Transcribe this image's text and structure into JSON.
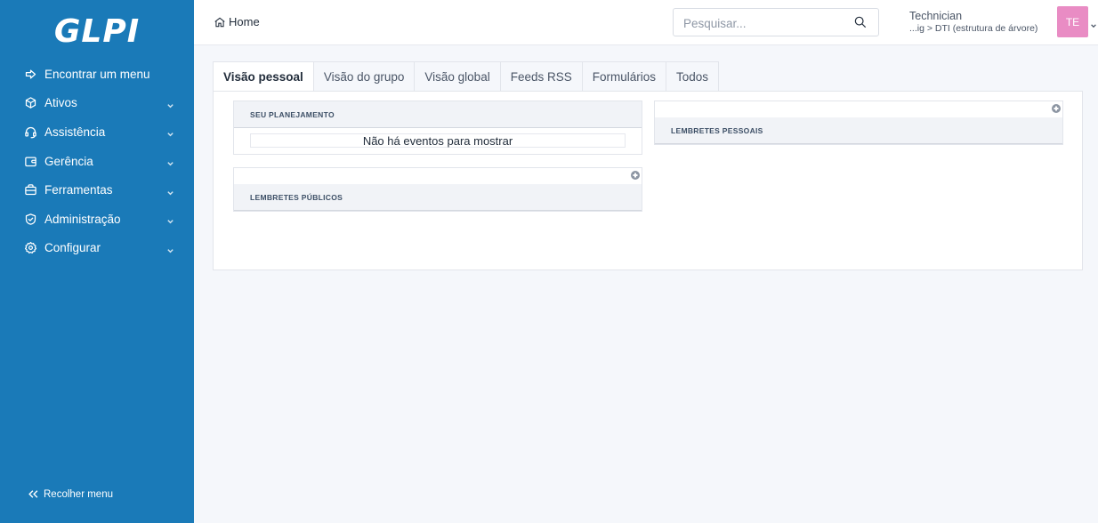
{
  "sidebar": {
    "logo": "GLPI",
    "items": [
      {
        "label": "Encontrar um menu",
        "icon": "arrow-right-icon",
        "has_chevron": false
      },
      {
        "label": "Ativos",
        "icon": "cube-icon",
        "has_chevron": true
      },
      {
        "label": "Assistência",
        "icon": "headset-icon",
        "has_chevron": true
      },
      {
        "label": "Gerência",
        "icon": "wallet-icon",
        "has_chevron": true
      },
      {
        "label": "Ferramentas",
        "icon": "briefcase-icon",
        "has_chevron": true
      },
      {
        "label": "Administração",
        "icon": "shield-check-icon",
        "has_chevron": true
      },
      {
        "label": "Configurar",
        "icon": "settings-icon",
        "has_chevron": true
      }
    ],
    "collapse_label": "Recolher menu"
  },
  "header": {
    "breadcrumb": "Home",
    "search_placeholder": "Pesquisar...",
    "user_name": "Technician",
    "user_entity": "...ig > DTI (estrutura de árvore)",
    "avatar_initials": "TE"
  },
  "tabs": [
    {
      "label": "Visão pessoal",
      "active": true
    },
    {
      "label": "Visão do grupo",
      "active": false
    },
    {
      "label": "Visão global",
      "active": false
    },
    {
      "label": "Feeds RSS",
      "active": false
    },
    {
      "label": "Formulários",
      "active": false
    },
    {
      "label": "Todos",
      "active": false
    }
  ],
  "cards": {
    "planning_title": "SEU PLANEJAMENTO",
    "planning_empty": "Não há eventos para mostrar",
    "public_reminders_title": "LEMBRETES PÚBLICOS",
    "personal_reminders_title": "LEMBRETES PESSOAIS"
  },
  "colors": {
    "sidebar": "#1a7ab8",
    "avatar": "#e98cc4",
    "background": "#f5f7fb"
  }
}
